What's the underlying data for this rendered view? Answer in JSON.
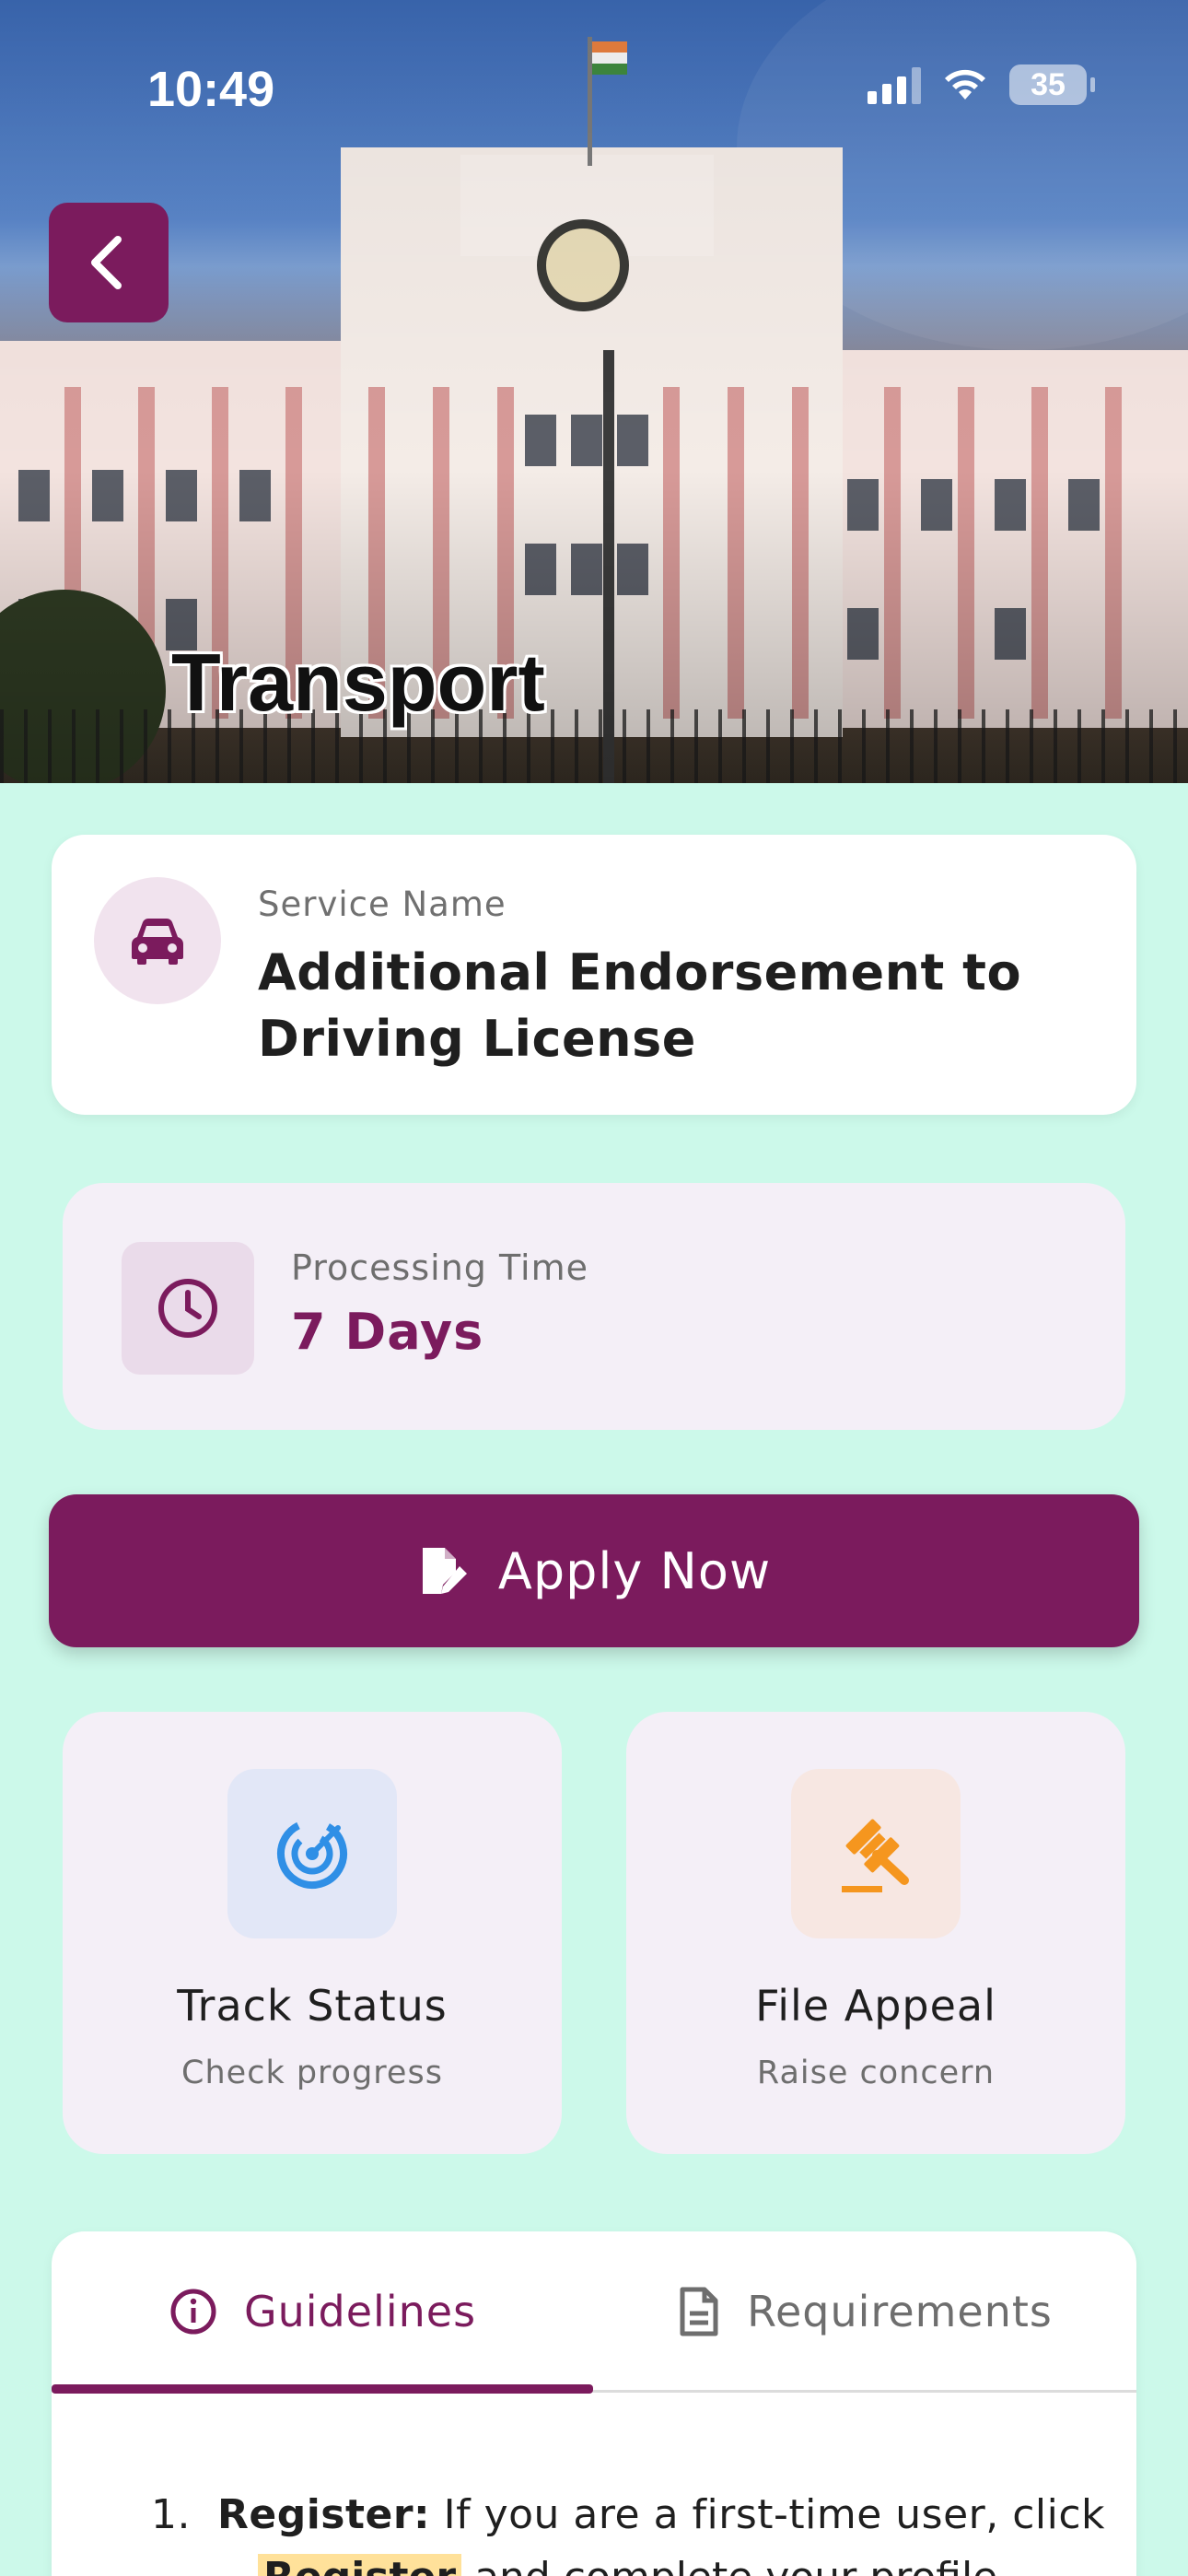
{
  "status_bar": {
    "time": "10:49",
    "battery": "35"
  },
  "header": {
    "title": "Transport"
  },
  "service": {
    "label": "Service Name",
    "value": "Additional Endorsement to Driving License",
    "icon": "car-icon"
  },
  "processing": {
    "label": "Processing Time",
    "value": "7 Days",
    "icon": "clock-icon"
  },
  "apply": {
    "label": "Apply Now",
    "icon": "edit-document-icon"
  },
  "actions": [
    {
      "title": "Track Status",
      "subtitle": "Check progress",
      "icon": "radar-icon",
      "color": "#2f8fe6"
    },
    {
      "title": "File Appeal",
      "subtitle": "Raise concern",
      "icon": "gavel-icon",
      "color": "#f5961e"
    }
  ],
  "tabs": [
    {
      "label": "Guidelines",
      "icon": "info-icon",
      "active": true
    },
    {
      "label": "Requirements",
      "icon": "document-icon",
      "active": false
    }
  ],
  "guidelines": {
    "item1_number": "1.",
    "item1_title": "Register:",
    "item1_text": "If you are a first-time user, click",
    "item1_highlight": "Register",
    "item1_rest": "and complete your profile"
  },
  "colors": {
    "brand": "#7b1b5d",
    "background": "#ccf9ea"
  }
}
